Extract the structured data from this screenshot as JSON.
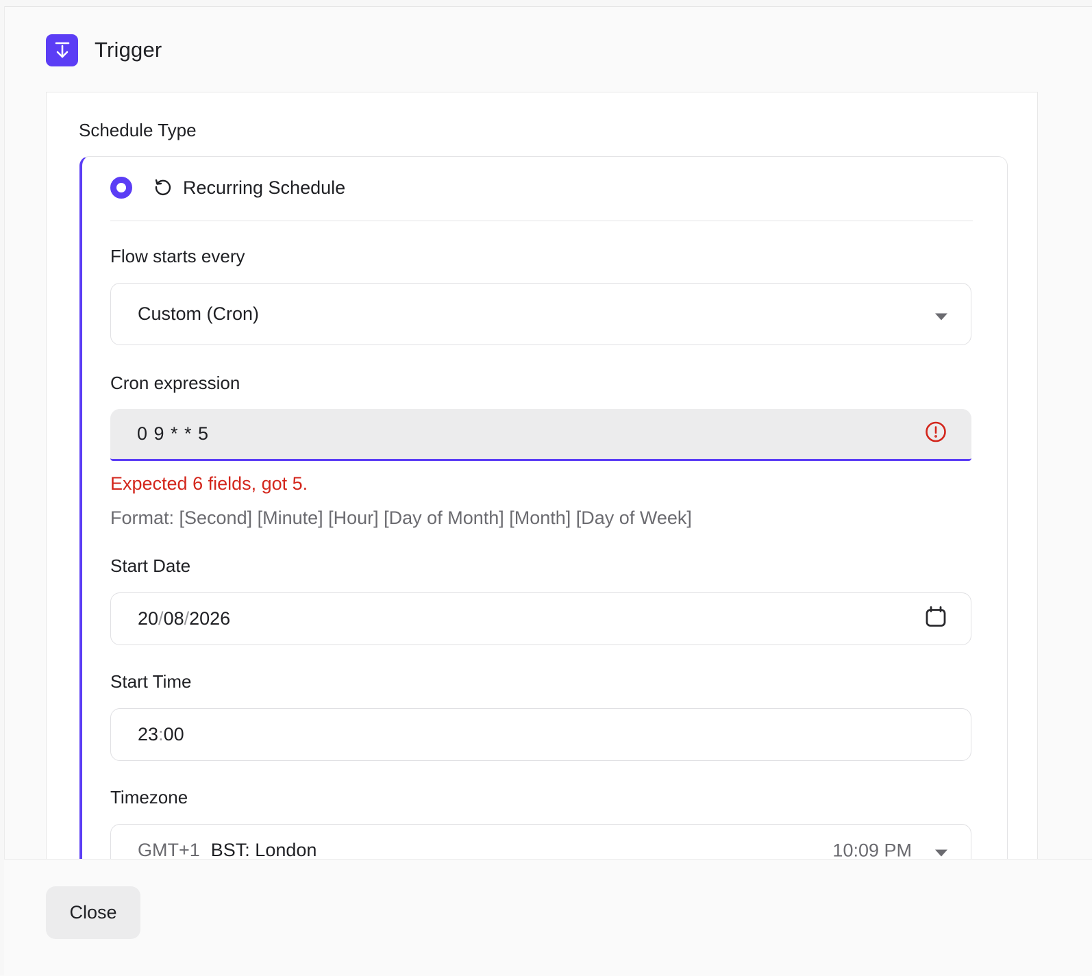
{
  "header": {
    "title": "Trigger",
    "icon": "arrow-down-to-line-icon",
    "accent": "#5b3df5"
  },
  "schedule": {
    "section_label": "Schedule Type",
    "option_label": "Recurring Schedule",
    "option_selected": true
  },
  "flow": {
    "label": "Flow starts every",
    "value": "Custom (Cron)"
  },
  "cron": {
    "label": "Cron expression",
    "value": "0 9 * * 5",
    "error": "Expected 6 fields, got 5.",
    "error_color": "#d3261c",
    "helper": "Format: [Second] [Minute] [Hour] [Day of Month] [Month] [Day of Week]"
  },
  "start_date": {
    "label": "Start Date",
    "day": "20",
    "month": "08",
    "year": "2026",
    "separator": "/"
  },
  "start_time": {
    "label": "Start Time",
    "hour": "23",
    "minute": "00",
    "separator": ":"
  },
  "timezone": {
    "label": "Timezone",
    "offset": "GMT+1",
    "name": "BST: London",
    "time": "10:09 PM"
  },
  "footer": {
    "close_label": "Close"
  }
}
